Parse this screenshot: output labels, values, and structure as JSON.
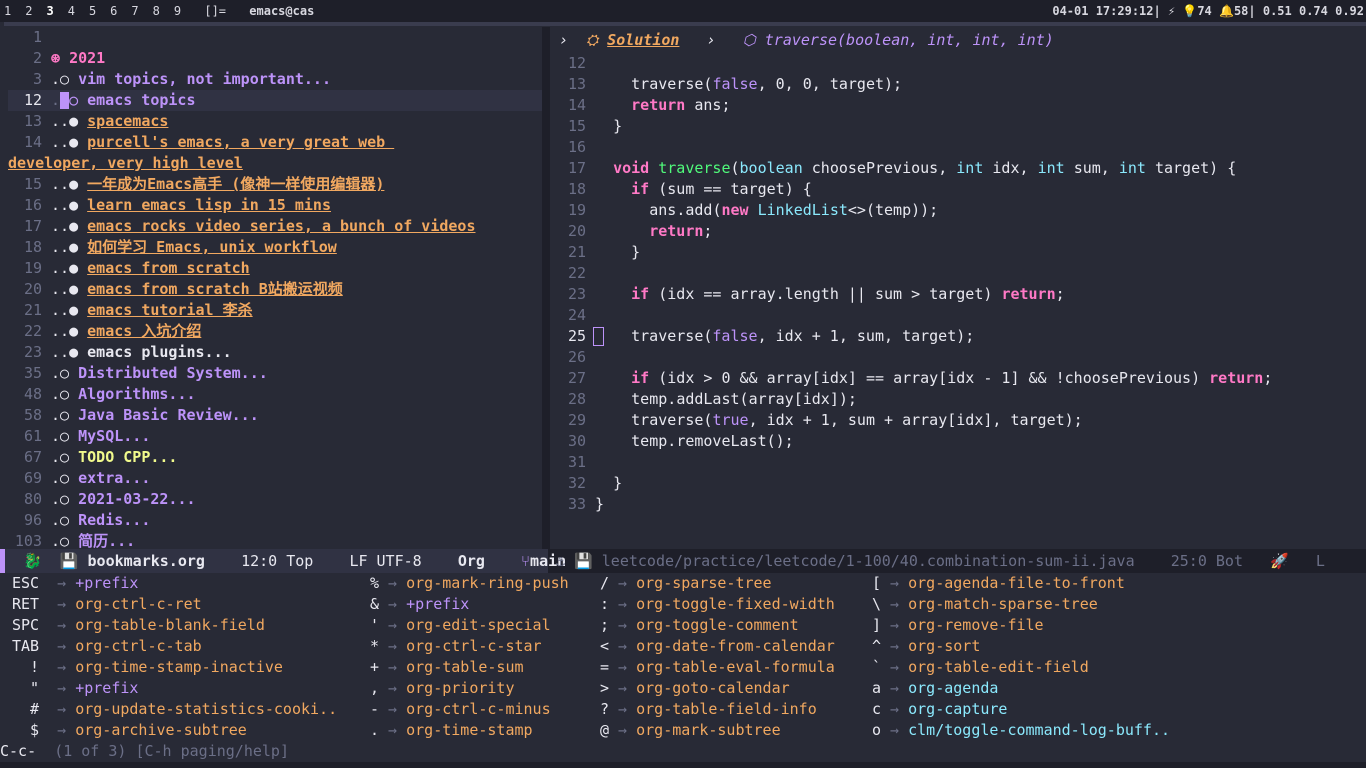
{
  "topbar": {
    "workspaces": [
      "1",
      "2",
      "3",
      "4",
      "5",
      "6",
      "7",
      "8",
      "9"
    ],
    "layout": "[]=",
    "window_title": "emacs@cas",
    "status": "04-01 17:29:12| ⚡ 💡74 🔔58| 0.51 0.74 0.92"
  },
  "left_pane": {
    "lines": [
      {
        "n": "1",
        "prefix": "",
        "text": "",
        "style": ""
      },
      {
        "n": "2",
        "prefix": "⊛ ",
        "text": "2021",
        "style": "org1"
      },
      {
        "n": "3",
        "prefix": ".○ ",
        "text": "vim topics, not important...",
        "style": "org2"
      },
      {
        "n": "12",
        "prefix": "",
        "text": "emacs topics",
        "style": "org2",
        "current": true
      },
      {
        "n": "13",
        "prefix": "..● ",
        "text": "spacemacs",
        "style": "link"
      },
      {
        "n": "14",
        "prefix": "..● ",
        "text": "purcell's emacs, a very great web ",
        "style": "link"
      },
      {
        "n": "",
        "prefix": "",
        "text": "developer, very high level",
        "style": "link",
        "cont": true
      },
      {
        "n": "15",
        "prefix": "..● ",
        "text": "一年成为Emacs高手 (像神一样使用编辑器)",
        "style": "link"
      },
      {
        "n": "16",
        "prefix": "..● ",
        "text": "learn emacs lisp in 15 mins",
        "style": "link"
      },
      {
        "n": "17",
        "prefix": "..● ",
        "text": "emacs rocks video series, a bunch of videos",
        "style": "link"
      },
      {
        "n": "18",
        "prefix": "..● ",
        "text": "如何学习 Emacs, unix workflow",
        "style": "link"
      },
      {
        "n": "19",
        "prefix": "..● ",
        "text": "emacs from scratch",
        "style": "link"
      },
      {
        "n": "20",
        "prefix": "..● ",
        "text": "emacs from scratch B站搬运视频",
        "style": "link"
      },
      {
        "n": "21",
        "prefix": "..● ",
        "text": "emacs tutorial 李杀",
        "style": "link"
      },
      {
        "n": "22",
        "prefix": "..● ",
        "text": "emacs 入坑介绍",
        "style": "link"
      },
      {
        "n": "23",
        "prefix": "..● ",
        "text": "emacs plugins...",
        "style": "org3"
      },
      {
        "n": "35",
        "prefix": ".○ ",
        "text": "Distributed System...",
        "style": "org2"
      },
      {
        "n": "48",
        "prefix": ".○ ",
        "text": "Algorithms...",
        "style": "org2"
      },
      {
        "n": "58",
        "prefix": ".○ ",
        "text": "Java Basic Review...",
        "style": "org2"
      },
      {
        "n": "61",
        "prefix": ".○ ",
        "text": "MySQL...",
        "style": "org2"
      },
      {
        "n": "67",
        "prefix": ".○ ",
        "text": "TODO CPP...",
        "style": "todo"
      },
      {
        "n": "69",
        "prefix": ".○ ",
        "text": "extra...",
        "style": "org2"
      },
      {
        "n": "80",
        "prefix": ".○ ",
        "text": "2021-03-22...",
        "style": "org2"
      },
      {
        "n": "96",
        "prefix": ".○ ",
        "text": "Redis...",
        "style": "org2"
      },
      {
        "n": "103",
        "prefix": ".○ ",
        "text": "简历...",
        "style": "org2"
      }
    ]
  },
  "right_pane": {
    "breadcrumb": {
      "class_name": "Solution",
      "method": "traverse(boolean, int, int, int)"
    },
    "code": [
      {
        "n": "12",
        "text": ""
      },
      {
        "n": "13",
        "text": "    traverse(false, 0, 0, target);"
      },
      {
        "n": "14",
        "text": "    return ans;"
      },
      {
        "n": "15",
        "text": "  }"
      },
      {
        "n": "16",
        "text": ""
      },
      {
        "n": "17",
        "text": "  void traverse(boolean choosePrevious, int idx, int sum, int target) {"
      },
      {
        "n": "18",
        "text": "    if (sum == target) {"
      },
      {
        "n": "19",
        "text": "      ans.add(new LinkedList<>(temp));"
      },
      {
        "n": "20",
        "text": "      return;"
      },
      {
        "n": "21",
        "text": "    }"
      },
      {
        "n": "22",
        "text": ""
      },
      {
        "n": "23",
        "text": "    if (idx == array.length || sum > target) return;"
      },
      {
        "n": "24",
        "text": ""
      },
      {
        "n": "25",
        "text": "    traverse(false, idx + 1, sum, target);",
        "current": true
      },
      {
        "n": "26",
        "text": ""
      },
      {
        "n": "27",
        "text": "    if (idx > 0 && array[idx] == array[idx - 1] && !choosePrevious) return;"
      },
      {
        "n": "28",
        "text": "    temp.addLast(array[idx]);"
      },
      {
        "n": "29",
        "text": "    traverse(true, idx + 1, sum + array[idx], target);"
      },
      {
        "n": "30",
        "text": "    temp.removeLast();"
      },
      {
        "n": "31",
        "text": ""
      },
      {
        "n": "32",
        "text": "  }"
      },
      {
        "n": "33",
        "text": "}"
      }
    ]
  },
  "modeline_left": {
    "file": "bookmarks.org",
    "position": "12:0 Top",
    "encoding": "LF UTF-8",
    "mode": "Org",
    "branch": "main"
  },
  "modeline_right": {
    "file": "leetcode/practice/leetcode/1-100/40.combination-sum-ii.java",
    "position": "25:0 Bot",
    "tail": "L"
  },
  "which_key": {
    "columns": [
      [
        {
          "k": "ESC",
          "c": "+prefix",
          "t": "prefix"
        },
        {
          "k": "RET",
          "c": "org-ctrl-c-ret",
          "t": "cmd"
        },
        {
          "k": "SPC",
          "c": "org-table-blank-field",
          "t": "cmd"
        },
        {
          "k": "TAB",
          "c": "org-ctrl-c-tab",
          "t": "cmd"
        },
        {
          "k": "  !",
          "c": "org-time-stamp-inactive",
          "t": "cmd"
        },
        {
          "k": "  \"",
          "c": "+prefix",
          "t": "prefix"
        },
        {
          "k": "  #",
          "c": "org-update-statistics-cooki..",
          "t": "cmd"
        },
        {
          "k": "  $",
          "c": "org-archive-subtree",
          "t": "cmd"
        }
      ],
      [
        {
          "k": "%",
          "c": "org-mark-ring-push",
          "t": "cmd"
        },
        {
          "k": "&",
          "c": "+prefix",
          "t": "prefix"
        },
        {
          "k": "'",
          "c": "org-edit-special",
          "t": "cmd"
        },
        {
          "k": "*",
          "c": "org-ctrl-c-star",
          "t": "cmd"
        },
        {
          "k": "+",
          "c": "org-table-sum",
          "t": "cmd"
        },
        {
          "k": ",",
          "c": "org-priority",
          "t": "cmd"
        },
        {
          "k": "-",
          "c": "org-ctrl-c-minus",
          "t": "cmd"
        },
        {
          "k": ".",
          "c": "org-time-stamp",
          "t": "cmd"
        }
      ],
      [
        {
          "k": "/",
          "c": "org-sparse-tree",
          "t": "cmd"
        },
        {
          "k": ":",
          "c": "org-toggle-fixed-width",
          "t": "cmd"
        },
        {
          "k": ";",
          "c": "org-toggle-comment",
          "t": "cmd"
        },
        {
          "k": "<",
          "c": "org-date-from-calendar",
          "t": "cmd"
        },
        {
          "k": "=",
          "c": "org-table-eval-formula",
          "t": "cmd"
        },
        {
          "k": ">",
          "c": "org-goto-calendar",
          "t": "cmd"
        },
        {
          "k": "?",
          "c": "org-table-field-info",
          "t": "cmd"
        },
        {
          "k": "@",
          "c": "org-mark-subtree",
          "t": "cmd"
        }
      ],
      [
        {
          "k": "[",
          "c": "org-agenda-file-to-front",
          "t": "cmd"
        },
        {
          "k": "\\",
          "c": "org-match-sparse-tree",
          "t": "cmd"
        },
        {
          "k": "]",
          "c": "org-remove-file",
          "t": "cmd"
        },
        {
          "k": "^",
          "c": "org-sort",
          "t": "cmd"
        },
        {
          "k": "`",
          "c": "org-table-edit-field",
          "t": "cmd"
        },
        {
          "k": "a",
          "c": "org-agenda",
          "t": "blue"
        },
        {
          "k": "c",
          "c": "org-capture",
          "t": "blue"
        },
        {
          "k": "o",
          "c": "clm/toggle-command-log-buff..",
          "t": "blue"
        }
      ]
    ]
  },
  "echo": {
    "keys": "C-c-",
    "hint": "(1 of 3) [C-h paging/help]"
  }
}
